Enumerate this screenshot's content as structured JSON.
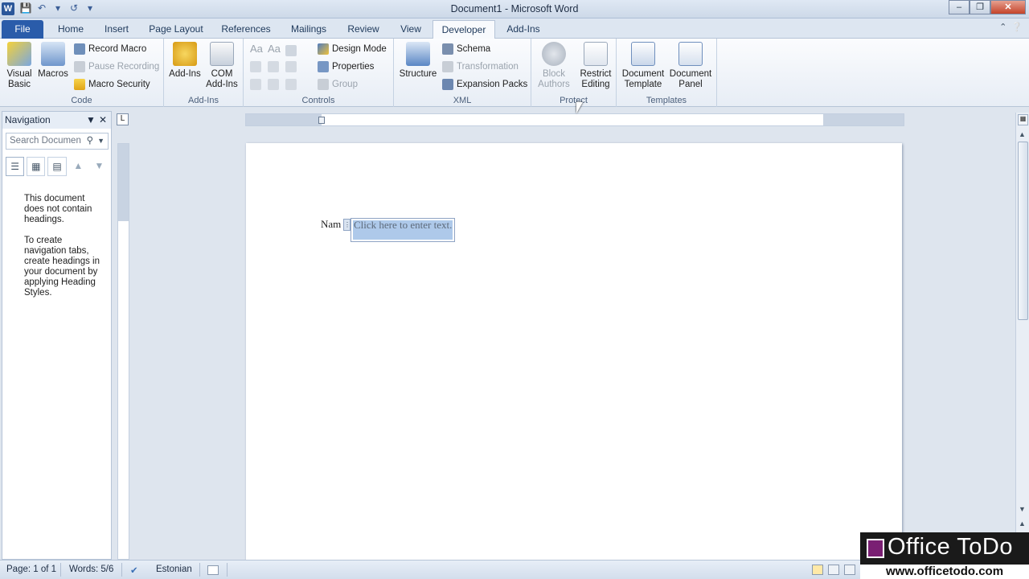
{
  "window": {
    "title": "Document1 - Microsoft Word",
    "app_icon": "W",
    "controls": [
      "minimize",
      "restore",
      "close"
    ]
  },
  "tabs": [
    {
      "label": "File"
    },
    {
      "label": "Home"
    },
    {
      "label": "Insert"
    },
    {
      "label": "Page Layout"
    },
    {
      "label": "References"
    },
    {
      "label": "Mailings"
    },
    {
      "label": "Review"
    },
    {
      "label": "View"
    },
    {
      "label": "Developer",
      "active": true
    },
    {
      "label": "Add-Ins"
    }
  ],
  "ribbon": {
    "code": {
      "label": "Code",
      "visual_basic": "Visual Basic",
      "macros": "Macros",
      "record_macro": "Record Macro",
      "pause_recording": "Pause Recording",
      "macro_security": "Macro Security"
    },
    "addins": {
      "label": "Add-Ins",
      "add_ins": "Add-Ins",
      "com_add_ins": "COM Add-Ins"
    },
    "controls": {
      "label": "Controls",
      "design_mode": "Design Mode",
      "properties": "Properties",
      "group": "Group"
    },
    "xml": {
      "label": "XML",
      "structure": "Structure",
      "schema": "Schema",
      "transformation": "Transformation",
      "expansion_packs": "Expansion Packs"
    },
    "protect": {
      "label": "Protect",
      "block_authors": "Block Authors",
      "restrict_editing": "Restrict Editing"
    },
    "templates": {
      "label": "Templates",
      "document_template": "Document Template",
      "document_panel": "Document Panel"
    }
  },
  "navigation": {
    "title": "Navigation",
    "search_placeholder": "Search Documen",
    "message1": "This document does not contain headings.",
    "message2": "To create navigation tabs, create headings in your document by applying Heading Styles."
  },
  "document": {
    "label_text": "Nam",
    "content_control_text": "Click here to enter text."
  },
  "status": {
    "page": "Page: 1 of 1",
    "words": "Words: 5/6",
    "language": "Estonian"
  },
  "watermark": {
    "title": "Office ToDo",
    "url": "www.officetodo.com"
  },
  "colors": {
    "file_tab": "#2a5caa",
    "selection": "#aec9ea",
    "word_blue": "#2b579a"
  }
}
